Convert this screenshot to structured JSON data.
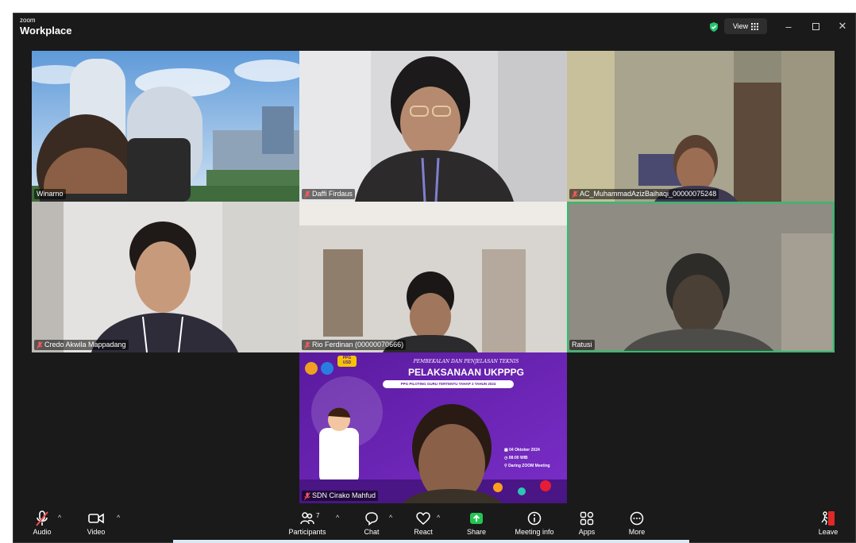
{
  "app": {
    "brand_small": "zoom",
    "brand_name": "Workplace",
    "view_label": "View"
  },
  "participants": [
    {
      "name": "Winarno",
      "muted": false
    },
    {
      "name": "Daffi Firdaus",
      "muted": true
    },
    {
      "name": "AC_MuhammadAzizBaihaqi_00000075248",
      "muted": true
    },
    {
      "name": "Credo Akwila Mappadang",
      "muted": true
    },
    {
      "name": "Rio Ferdinan (00000070666)",
      "muted": true
    },
    {
      "name": "Ratusi",
      "muted": false,
      "active_speaker": true
    },
    {
      "name": "SDN Cirako Mahfud",
      "muted": true
    }
  ],
  "banner": {
    "line1": "PEMBEKALAN DAN PENJELASAN TEKNIS",
    "line2": "PELAKSANAAN UKPPPG",
    "line3": "PPG PILOTING GURU TERTENTU TAHAP 2 TAHUN 2024",
    "logo_text_top": "PPG",
    "logo_text_bottom": "USD",
    "date": "04 Oktober 2024",
    "time": "08:00 WIB",
    "place": "Daring ZOOM Meeting"
  },
  "toolbar": {
    "audio": "Audio",
    "video": "Video",
    "participants": "Participants",
    "participants_count": "7",
    "chat": "Chat",
    "react": "React",
    "share": "Share",
    "meeting_info": "Meeting info",
    "apps": "Apps",
    "more": "More",
    "leave": "Leave"
  },
  "colors": {
    "active_speaker_border": "#27c26d",
    "share_button": "#23c552",
    "leave_button": "#e02828",
    "shield": "#27c26d",
    "banner_purple": "#6a1fb3"
  }
}
